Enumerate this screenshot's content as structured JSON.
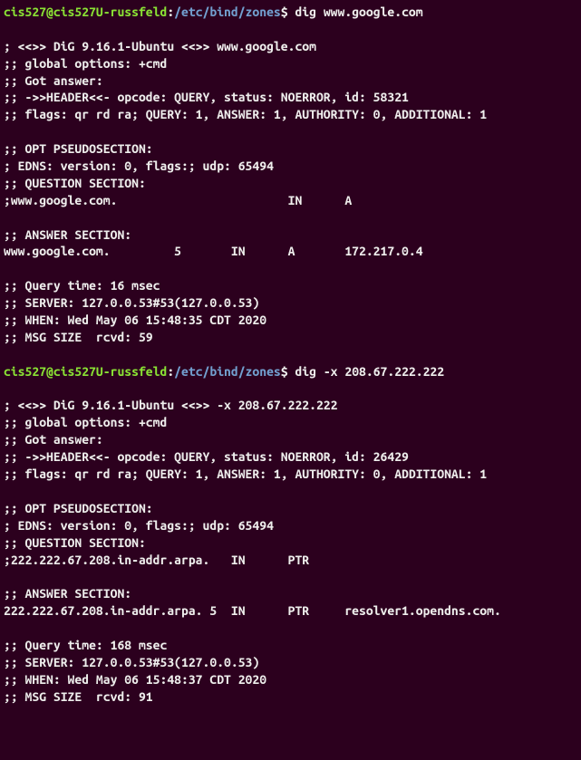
{
  "block1": {
    "prompt": {
      "user": "cis527@cis527U-russfeld",
      "path": "/etc/bind/zones"
    },
    "command": "dig www.google.com",
    "output": "\n; <<>> DiG 9.16.1-Ubuntu <<>> www.google.com\n;; global options: +cmd\n;; Got answer:\n;; ->>HEADER<<- opcode: QUERY, status: NOERROR, id: 58321\n;; flags: qr rd ra; QUERY: 1, ANSWER: 1, AUTHORITY: 0, ADDITIONAL: 1\n\n;; OPT PSEUDOSECTION:\n; EDNS: version: 0, flags:; udp: 65494\n;; QUESTION SECTION:\n;www.google.com.                        IN      A\n\n;; ANSWER SECTION:\nwww.google.com.         5       IN      A       172.217.0.4\n\n;; Query time: 16 msec\n;; SERVER: 127.0.0.53#53(127.0.0.53)\n;; WHEN: Wed May 06 15:48:35 CDT 2020\n;; MSG SIZE  rcvd: 59\n"
  },
  "block2": {
    "prompt": {
      "user": "cis527@cis527U-russfeld",
      "path": "/etc/bind/zones"
    },
    "command": "dig -x 208.67.222.222",
    "output": "\n; <<>> DiG 9.16.1-Ubuntu <<>> -x 208.67.222.222\n;; global options: +cmd\n;; Got answer:\n;; ->>HEADER<<- opcode: QUERY, status: NOERROR, id: 26429\n;; flags: qr rd ra; QUERY: 1, ANSWER: 1, AUTHORITY: 0, ADDITIONAL: 1\n\n;; OPT PSEUDOSECTION:\n; EDNS: version: 0, flags:; udp: 65494\n;; QUESTION SECTION:\n;222.222.67.208.in-addr.arpa.   IN      PTR\n\n;; ANSWER SECTION:\n222.222.67.208.in-addr.arpa. 5  IN      PTR     resolver1.opendns.com.\n\n;; Query time: 168 msec\n;; SERVER: 127.0.0.53#53(127.0.0.53)\n;; WHEN: Wed May 06 15:48:37 CDT 2020\n;; MSG SIZE  rcvd: 91"
  }
}
